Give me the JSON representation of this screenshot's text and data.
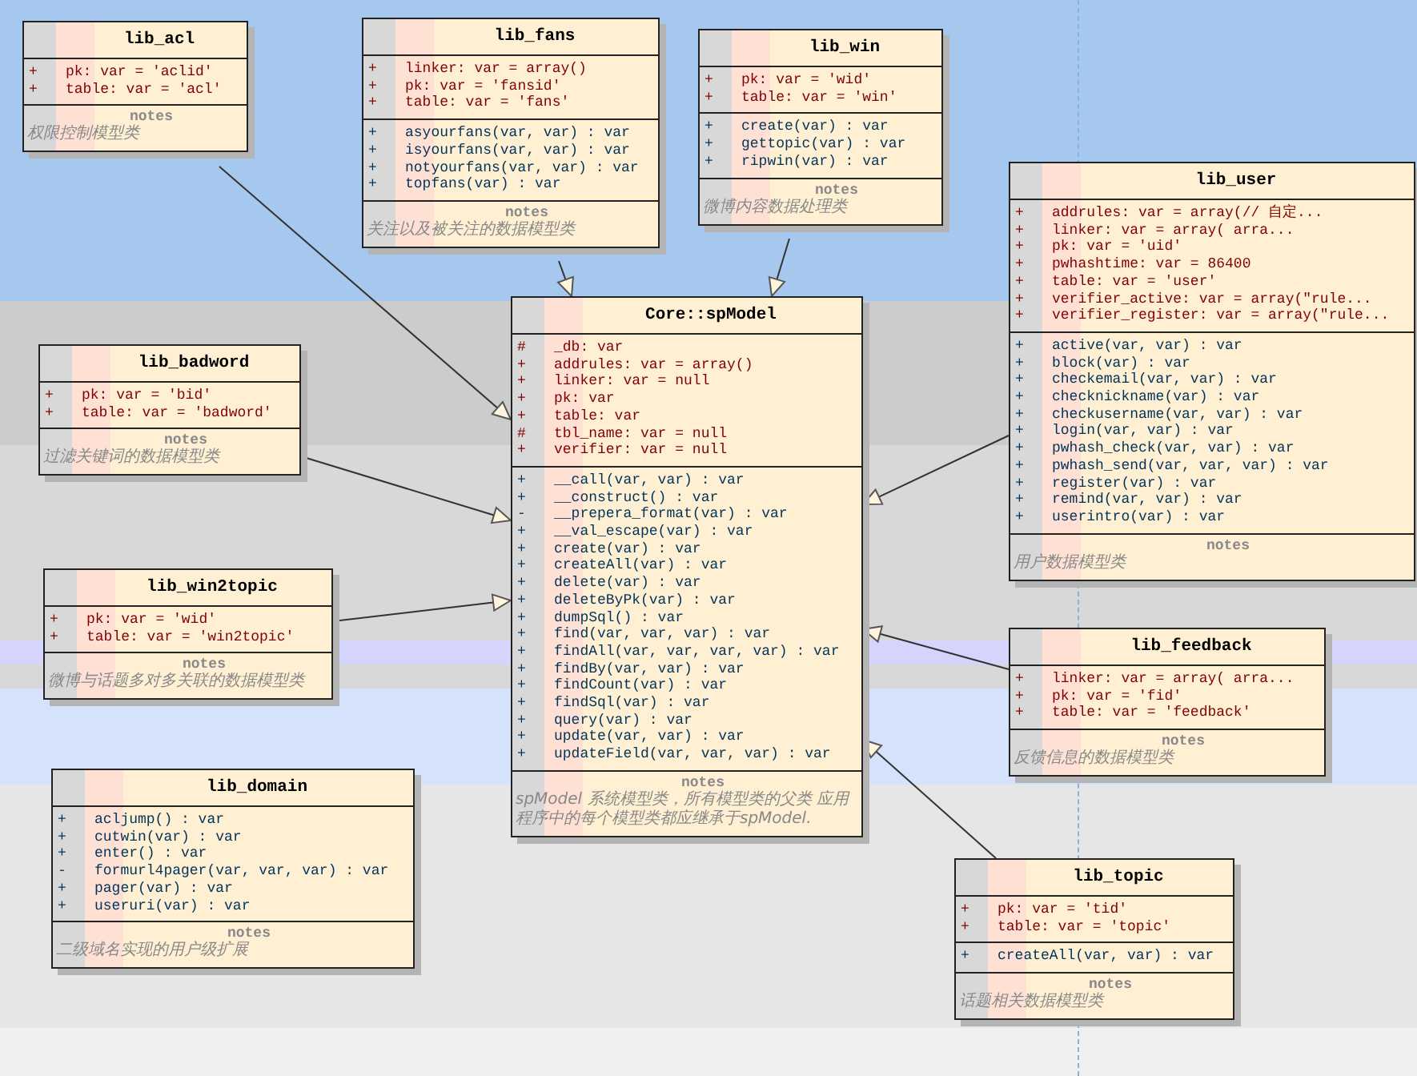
{
  "classes": [
    {
      "name": "lib_acl",
      "inherits": true,
      "attributes": [
        {
          "visibility": "+",
          "text": "pk:  var = 'aclid'"
        },
        {
          "visibility": "+",
          "text": "table:  var = 'acl'"
        }
      ],
      "notes_label": "notes",
      "notes": "权限控制模型类"
    },
    {
      "name": "lib_fans",
      "inherits": true,
      "attributes": [
        {
          "visibility": "+",
          "text": "linker:  var = array()"
        },
        {
          "visibility": "+",
          "text": "pk:  var = 'fansid'"
        },
        {
          "visibility": "+",
          "text": "table:  var = 'fans'"
        }
      ],
      "operations": [
        {
          "visibility": "+",
          "text": "asyourfans(var, var) : var"
        },
        {
          "visibility": "+",
          "text": "isyourfans(var, var) : var"
        },
        {
          "visibility": "+",
          "text": "notyourfans(var, var) : var"
        },
        {
          "visibility": "+",
          "text": "topfans(var) : var"
        }
      ],
      "notes_label": "notes",
      "notes": "关注以及被关注的数据模型类"
    },
    {
      "name": "lib_win",
      "inherits": true,
      "attributes": [
        {
          "visibility": "+",
          "text": "pk:  var = 'wid'"
        },
        {
          "visibility": "+",
          "text": "table:  var = 'win'"
        }
      ],
      "operations": [
        {
          "visibility": "+",
          "text": "create(var) : var"
        },
        {
          "visibility": "+",
          "text": "gettopic(var) : var"
        },
        {
          "visibility": "+",
          "text": "ripwin(var) : var"
        }
      ],
      "notes_label": "notes",
      "notes": "微博内容数据处理类"
    },
    {
      "name": "lib_user",
      "inherits": true,
      "attributes": [
        {
          "visibility": "+",
          "text": "addrules:  var = array(// 自定..."
        },
        {
          "visibility": "+",
          "text": "linker:  var = array( arra..."
        },
        {
          "visibility": "+",
          "text": "pk:  var = 'uid'"
        },
        {
          "visibility": "+",
          "text": "pwhashtime:  var = 86400"
        },
        {
          "visibility": "+",
          "text": "table:  var = 'user'"
        },
        {
          "visibility": "+",
          "text": "verifier_active:  var = array(\"rule..."
        },
        {
          "visibility": "+",
          "text": "verifier_register:  var = array(\"rule..."
        }
      ],
      "operations": [
        {
          "visibility": "+",
          "text": "active(var, var) : var"
        },
        {
          "visibility": "+",
          "text": "block(var) : var"
        },
        {
          "visibility": "+",
          "text": "checkemail(var, var) : var"
        },
        {
          "visibility": "+",
          "text": "checknickname(var) : var"
        },
        {
          "visibility": "+",
          "text": "checkusername(var, var) : var"
        },
        {
          "visibility": "+",
          "text": "login(var, var) : var"
        },
        {
          "visibility": "+",
          "text": "pwhash_check(var, var) : var"
        },
        {
          "visibility": "+",
          "text": "pwhash_send(var, var, var) : var"
        },
        {
          "visibility": "+",
          "text": "register(var) : var"
        },
        {
          "visibility": "+",
          "text": "remind(var, var) : var"
        },
        {
          "visibility": "+",
          "text": "userintro(var) : var"
        }
      ],
      "notes_label": "notes",
      "notes": "用户数据模型类"
    },
    {
      "name": "Core::spModel",
      "inherits": false,
      "attributes": [
        {
          "visibility": "#",
          "text": "_db:  var"
        },
        {
          "visibility": "+",
          "text": "addrules:  var = array()"
        },
        {
          "visibility": "+",
          "text": "linker:  var = null"
        },
        {
          "visibility": "+",
          "text": "pk:  var"
        },
        {
          "visibility": "+",
          "text": "table:  var"
        },
        {
          "visibility": "#",
          "text": "tbl_name:  var = null"
        },
        {
          "visibility": "+",
          "text": "verifier:  var = null"
        }
      ],
      "operations": [
        {
          "visibility": "+",
          "text": "__call(var, var) : var"
        },
        {
          "visibility": "+",
          "text": "__construct() : var"
        },
        {
          "visibility": "-",
          "text": "__prepera_format(var) : var"
        },
        {
          "visibility": "+",
          "text": "__val_escape(var) : var"
        },
        {
          "visibility": "+",
          "text": "create(var) : var"
        },
        {
          "visibility": "+",
          "text": "createAll(var) : var"
        },
        {
          "visibility": "+",
          "text": "delete(var) : var"
        },
        {
          "visibility": "+",
          "text": "deleteByPk(var) : var"
        },
        {
          "visibility": "+",
          "text": "dumpSql() : var"
        },
        {
          "visibility": "+",
          "text": "find(var, var, var) : var"
        },
        {
          "visibility": "+",
          "text": "findAll(var, var, var, var) : var"
        },
        {
          "visibility": "+",
          "text": "findBy(var, var) : var"
        },
        {
          "visibility": "+",
          "text": "findCount(var) : var"
        },
        {
          "visibility": "+",
          "text": "findSql(var) : var"
        },
        {
          "visibility": "+",
          "text": "query(var) : var"
        },
        {
          "visibility": "+",
          "text": "update(var, var) : var"
        },
        {
          "visibility": "+",
          "text": "updateField(var, var, var) : var"
        }
      ],
      "notes_label": "notes",
      "notes": "spModel 系统模型类，所有模型类的父类 应用程序中的每个模型类都应继承于spModel."
    },
    {
      "name": "lib_badword",
      "inherits": true,
      "attributes": [
        {
          "visibility": "+",
          "text": "pk:  var = 'bid'"
        },
        {
          "visibility": "+",
          "text": "table:  var = 'badword'"
        }
      ],
      "notes_label": "notes",
      "notes": "过滤关键词的数据模型类"
    },
    {
      "name": "lib_win2topic",
      "inherits": true,
      "attributes": [
        {
          "visibility": "+",
          "text": "pk:  var = 'wid'"
        },
        {
          "visibility": "+",
          "text": "table:  var = 'win2topic'"
        }
      ],
      "notes_label": "notes",
      "notes": "微博与话题多对多关联的数据模型类"
    },
    {
      "name": "lib_domain",
      "inherits": false,
      "operations": [
        {
          "visibility": "+",
          "text": "acljump() : var"
        },
        {
          "visibility": "+",
          "text": "cutwin(var) : var"
        },
        {
          "visibility": "+",
          "text": "enter() : var"
        },
        {
          "visibility": "-",
          "text": "formurl4pager(var, var, var) : var"
        },
        {
          "visibility": "+",
          "text": "pager(var) : var"
        },
        {
          "visibility": "+",
          "text": "useruri(var) : var"
        }
      ],
      "notes_label": "notes",
      "notes": "二级域名实现的用户级扩展"
    },
    {
      "name": "lib_feedback",
      "inherits": true,
      "attributes": [
        {
          "visibility": "+",
          "text": "linker:  var = array( arra..."
        },
        {
          "visibility": "+",
          "text": "pk:  var = 'fid'"
        },
        {
          "visibility": "+",
          "text": "table:  var = 'feedback'"
        }
      ],
      "notes_label": "notes",
      "notes": "反馈信息的数据模型类"
    },
    {
      "name": "lib_topic",
      "inherits": true,
      "attributes": [
        {
          "visibility": "+",
          "text": "pk:  var = 'tid'"
        },
        {
          "visibility": "+",
          "text": "table:  var = 'topic'"
        }
      ],
      "operations": [
        {
          "visibility": "+",
          "text": "createAll(var, var) : var"
        }
      ],
      "notes_label": "notes",
      "notes": "话题相关数据模型类"
    }
  ]
}
